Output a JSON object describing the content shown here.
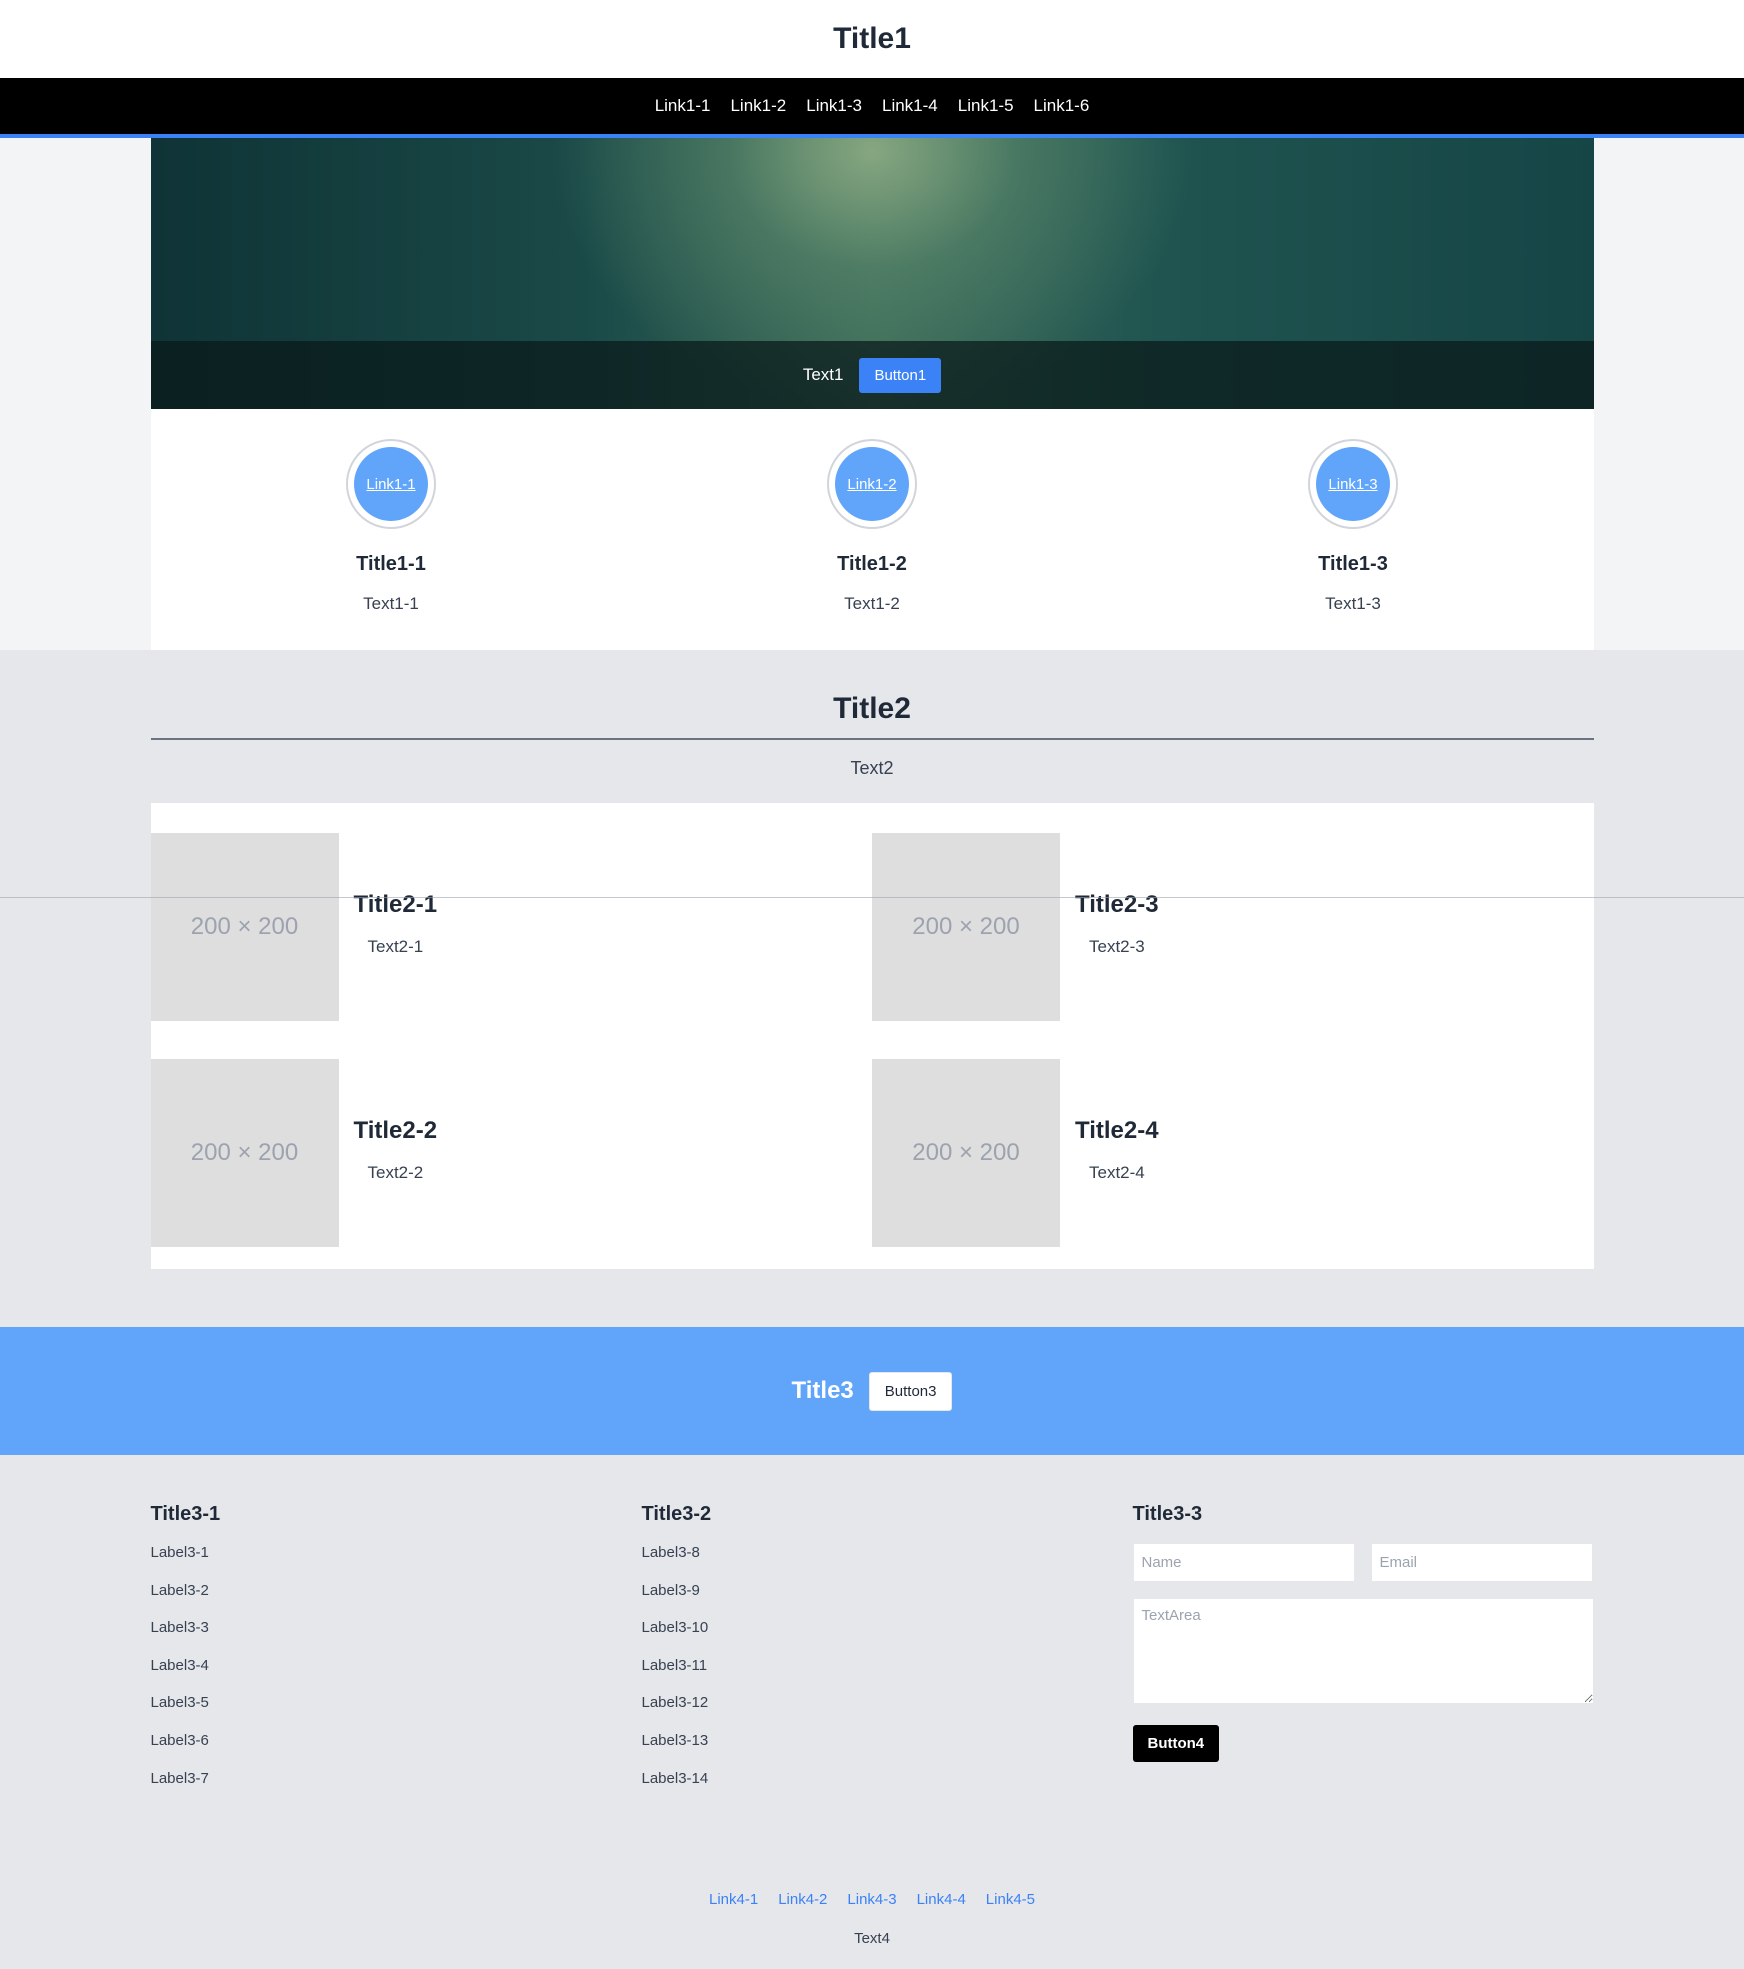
{
  "header": {
    "title": "Title1"
  },
  "nav": {
    "links": [
      "Link1-1",
      "Link1-2",
      "Link1-3",
      "Link1-4",
      "Link1-5",
      "Link1-6"
    ]
  },
  "hero": {
    "text": "Text1",
    "button": "Button1"
  },
  "features": [
    {
      "circle": "Link1-1",
      "title": "Title1-1",
      "text": "Text1-1"
    },
    {
      "circle": "Link1-2",
      "title": "Title1-2",
      "text": "Text1-2"
    },
    {
      "circle": "Link1-3",
      "title": "Title1-3",
      "text": "Text1-3"
    }
  ],
  "section2": {
    "title": "Title2",
    "text": "Text2",
    "cards": [
      {
        "image": "200 × 200",
        "title": "Title2-1",
        "text": "Text2-1"
      },
      {
        "image": "200 × 200",
        "title": "Title2-3",
        "text": "Text2-3"
      },
      {
        "image": "200 × 200",
        "title": "Title2-2",
        "text": "Text2-2"
      },
      {
        "image": "200 × 200",
        "title": "Title2-4",
        "text": "Text2-4"
      }
    ]
  },
  "cta": {
    "title": "Title3",
    "button": "Button3"
  },
  "footer": {
    "col1": {
      "title": "Title3-1",
      "items": [
        "Label3-1",
        "Label3-2",
        "Label3-3",
        "Label3-4",
        "Label3-5",
        "Label3-6",
        "Label3-7"
      ]
    },
    "col2": {
      "title": "Title3-2",
      "items": [
        "Label3-8",
        "Label3-9",
        "Label3-10",
        "Label3-11",
        "Label3-12",
        "Label3-13",
        "Label3-14"
      ]
    },
    "col3": {
      "title": "Title3-3",
      "name_placeholder": "Name",
      "email_placeholder": "Email",
      "textarea_placeholder": "TextArea",
      "button": "Button4"
    },
    "links": [
      "Link4-1",
      "Link4-2",
      "Link4-3",
      "Link4-4",
      "Link4-5"
    ],
    "text": "Text4"
  },
  "colors": {
    "accent": "#3b82f6",
    "cta_background": "#60a5fa",
    "navbar_background": "#000000"
  }
}
